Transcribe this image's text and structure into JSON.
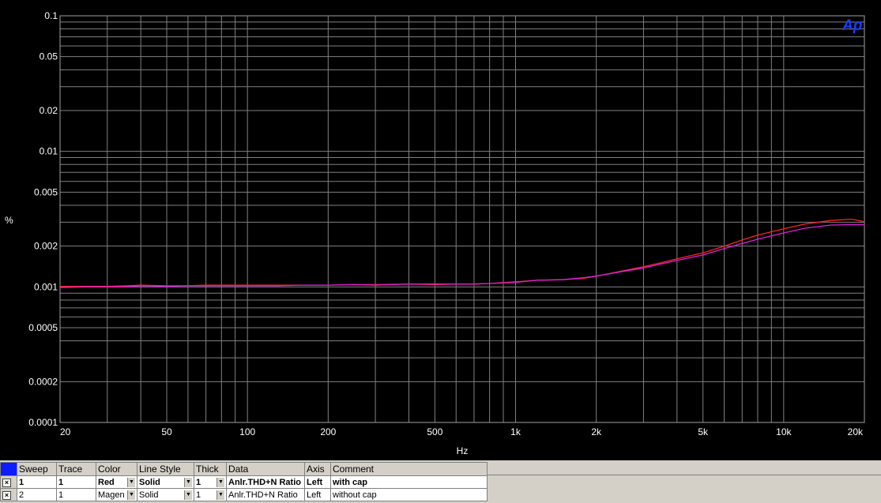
{
  "chart_data": {
    "type": "line",
    "xlabel": "Hz",
    "ylabel": "%",
    "x_scale": "log",
    "y_scale": "log",
    "xlim": [
      20,
      20000
    ],
    "ylim": [
      0.0001,
      0.1
    ],
    "grid": true,
    "x_ticks": [
      {
        "value": 20,
        "label": "20"
      },
      {
        "value": 50,
        "label": "50"
      },
      {
        "value": 100,
        "label": "100"
      },
      {
        "value": 200,
        "label": "200"
      },
      {
        "value": 500,
        "label": "500"
      },
      {
        "value": 1000,
        "label": "1k"
      },
      {
        "value": 2000,
        "label": "2k"
      },
      {
        "value": 5000,
        "label": "5k"
      },
      {
        "value": 10000,
        "label": "10k"
      },
      {
        "value": 20000,
        "label": "20k"
      }
    ],
    "y_ticks": [
      {
        "value": 0.1,
        "label": "0.1"
      },
      {
        "value": 0.05,
        "label": "0.05"
      },
      {
        "value": 0.02,
        "label": "0.02"
      },
      {
        "value": 0.01,
        "label": "0.01"
      },
      {
        "value": 0.005,
        "label": "0.005"
      },
      {
        "value": 0.002,
        "label": "0.002"
      },
      {
        "value": 0.001,
        "label": "0.001"
      },
      {
        "value": 0.0005,
        "label": "0.0005"
      },
      {
        "value": 0.0002,
        "label": "0.0002"
      },
      {
        "value": 0.0001,
        "label": "0.0001"
      }
    ],
    "logo_text": "Ap",
    "series": [
      {
        "name": "with cap",
        "color": "#ff2020",
        "x": [
          20,
          25,
          30,
          35,
          40,
          50,
          60,
          70,
          80,
          100,
          130,
          160,
          200,
          250,
          300,
          400,
          500,
          600,
          700,
          800,
          1000,
          1200,
          1500,
          1800,
          2000,
          2500,
          3000,
          3500,
          4000,
          5000,
          6000,
          7000,
          8000,
          10000,
          12000,
          15000,
          18000,
          20000
        ],
        "y": [
          0.00101,
          0.00101,
          0.00101,
          0.00102,
          0.00103,
          0.00102,
          0.00102,
          0.00103,
          0.00103,
          0.00103,
          0.00103,
          0.00103,
          0.00103,
          0.00104,
          0.00104,
          0.00105,
          0.00104,
          0.00105,
          0.00105,
          0.00106,
          0.00109,
          0.00112,
          0.00113,
          0.00116,
          0.0012,
          0.00131,
          0.00141,
          0.00151,
          0.00161,
          0.00178,
          0.002,
          0.00222,
          0.00241,
          0.00268,
          0.00291,
          0.00309,
          0.00316,
          0.00302
        ]
      },
      {
        "name": "without cap",
        "color": "#e020e0",
        "x": [
          20,
          25,
          30,
          35,
          40,
          50,
          60,
          70,
          80,
          100,
          130,
          160,
          200,
          250,
          300,
          400,
          500,
          600,
          700,
          800,
          1000,
          1200,
          1500,
          1800,
          2000,
          2500,
          3000,
          3500,
          4000,
          5000,
          6000,
          7000,
          8000,
          10000,
          12000,
          15000,
          18000,
          20000
        ],
        "y": [
          0.00099,
          0.001,
          0.001,
          0.001,
          0.00102,
          0.00101,
          0.00102,
          0.00102,
          0.00102,
          0.00102,
          0.00102,
          0.00103,
          0.00103,
          0.00104,
          0.00103,
          0.00105,
          0.00105,
          0.00105,
          0.00105,
          0.00106,
          0.00108,
          0.00112,
          0.00113,
          0.00117,
          0.0012,
          0.0013,
          0.00138,
          0.00148,
          0.00157,
          0.00172,
          0.00192,
          0.00209,
          0.00225,
          0.0025,
          0.00271,
          0.00286,
          0.00288,
          0.00287
        ]
      }
    ]
  },
  "legend": {
    "headers": [
      "Sweep",
      "Trace",
      "Color",
      "Line Style",
      "Thick",
      "Data",
      "Axis",
      "Comment"
    ],
    "rows": [
      {
        "mark": "×",
        "sweep": "1",
        "trace": "1",
        "color": "Red",
        "style": "Solid",
        "thick": "1",
        "data": "Anlr.THD+N Ratio",
        "axis": "Left",
        "comment": "with cap"
      },
      {
        "mark": "×",
        "sweep": "2",
        "trace": "1",
        "color": "Magen",
        "style": "Solid",
        "thick": "1",
        "data": "Anlr.THD+N Ratio",
        "axis": "Left",
        "comment": "without cap"
      }
    ]
  }
}
